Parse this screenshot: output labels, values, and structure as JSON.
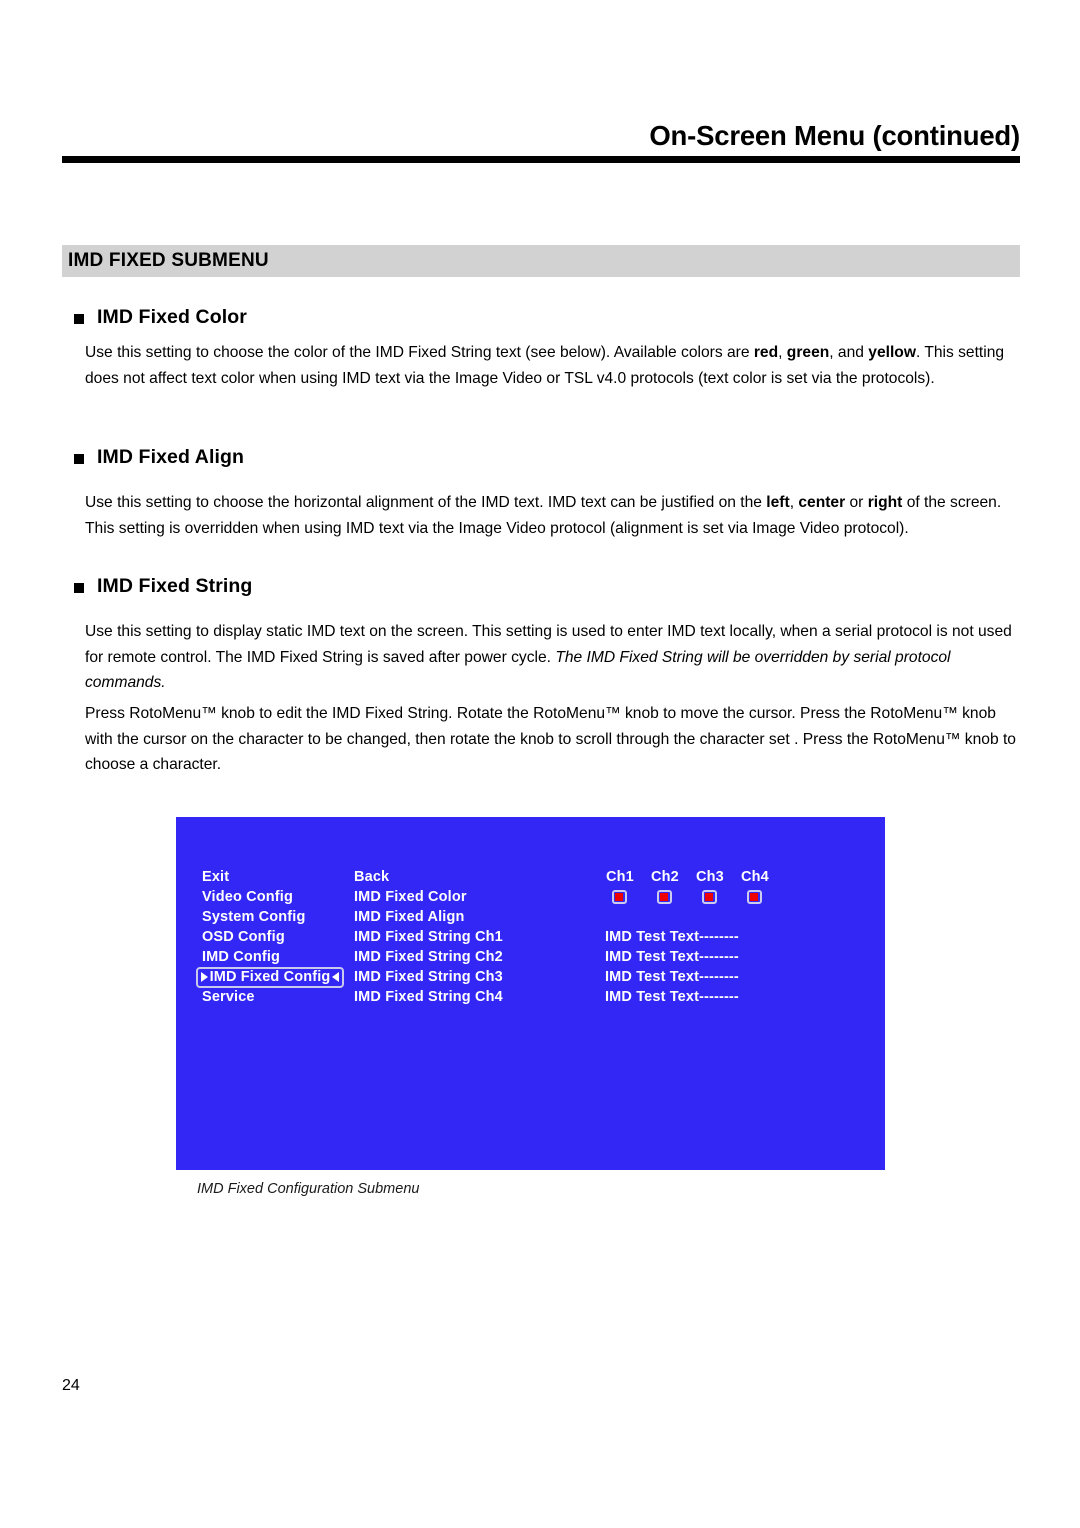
{
  "header": {
    "title": "On-Screen Menu (continued)"
  },
  "section": {
    "title": "IMD FIXED SUBMENU"
  },
  "sections": [
    {
      "heading": "IMD Fixed Color",
      "paragraphs": [
        "Use this setting to choose the color of the IMD Fixed String text (see below). Available colors are <b>red</b>, <b>green</b>, and <b>yellow</b>. This setting does not affect text color when using IMD text via the Image Video or TSL v4.0 protocols (text color is set via the protocols)."
      ]
    },
    {
      "heading": "IMD Fixed Align",
      "paragraphs": [
        "Use this setting to choose the horizontal alignment of the IMD text. IMD text can be justified on the <b>left</b>, <b>center</b> or <b>right</b> of the screen. This setting is overridden when using IMD text via the Image Video protocol (alignment is set via Image Video protocol)."
      ]
    },
    {
      "heading": "IMD Fixed String",
      "paragraphs": [
        "Use this setting to display static IMD text on the screen. This setting is used to enter IMD text locally, when a serial protocol is not used for remote control. The IMD Fixed String is saved after power cycle. <i>The IMD Fixed String will be overridden by serial protocol commands.</i>",
        "Press RotoMenu™ knob  to edit the IMD Fixed String. Rotate the RotoMenu™ knob  to move the cursor. Press the RotoMenu™ knob with the cursor on the character to be changed, then rotate the knob to scroll through the character set . Press the RotoMenu™ knob to choose a character."
      ]
    }
  ],
  "osd": {
    "background_color": "#3327f5",
    "led_color": "#ee0000",
    "left_menu": [
      "Exit",
      "Video Config",
      "System Config",
      "OSD Config",
      "IMD Config",
      "IMD Fixed Config",
      "Service"
    ],
    "selected_left_item": "IMD Fixed Config",
    "mid_menu": [
      "Back",
      "IMD Fixed Color",
      "IMD Fixed Align",
      "IMD Fixed String Ch1",
      "IMD Fixed String Ch2",
      "IMD Fixed String Ch3",
      "IMD Fixed String Ch4"
    ],
    "channel_headers": [
      "Ch1",
      "Ch2",
      "Ch3",
      "Ch4"
    ],
    "channel_indicators": [
      "red",
      "red",
      "red",
      "red"
    ],
    "values": [
      "IMD Test Text--------",
      "IMD Test Text--------",
      "IMD Test Text--------",
      "IMD Test Text--------"
    ]
  },
  "figure_caption": "IMD Fixed Configuration Submenu",
  "page_number": "24"
}
